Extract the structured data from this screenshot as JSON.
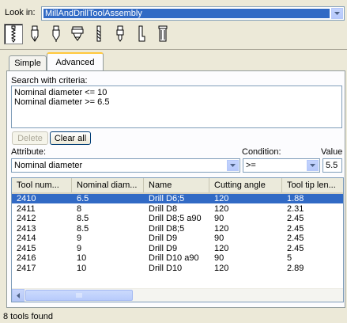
{
  "lookin": {
    "label": "Look in:",
    "value": "MillAndDrillToolAssembly"
  },
  "tools": [
    {
      "name": "drill-bit-icon"
    },
    {
      "name": "end-mill-icon"
    },
    {
      "name": "ball-mill-icon"
    },
    {
      "name": "face-mill-icon"
    },
    {
      "name": "reamer-icon"
    },
    {
      "name": "tap-icon"
    },
    {
      "name": "boring-bar-icon"
    },
    {
      "name": "holder-icon"
    }
  ],
  "tabs": {
    "simple": "Simple",
    "advanced": "Advanced"
  },
  "criteria": {
    "label": "Search with criteria:",
    "lines": [
      "Nominal diameter <= 10",
      "Nominal diameter >= 6.5"
    ]
  },
  "buttons": {
    "delete": "Delete",
    "clear_all": "Clear all"
  },
  "attribute": {
    "label": "Attribute:",
    "value": "Nominal diameter"
  },
  "condition": {
    "label": "Condition:",
    "value": ">="
  },
  "value": {
    "label": "Value",
    "value": "5.5"
  },
  "table": {
    "columns": [
      "Tool num...",
      "Nominal diam...",
      "Name",
      "Cutting angle",
      "Tool tip len..."
    ],
    "rows": [
      [
        "2410",
        "6.5",
        "Drill D6;5",
        "120",
        "1.88"
      ],
      [
        "2411",
        "8",
        "Drill D8",
        "120",
        "2.31"
      ],
      [
        "2412",
        "8.5",
        "Drill D8;5 a90",
        "90",
        "2.45"
      ],
      [
        "2413",
        "8.5",
        "Drill D8;5",
        "120",
        "2.45"
      ],
      [
        "2414",
        "9",
        "Drill D9",
        "90",
        "2.45"
      ],
      [
        "2415",
        "9",
        "Drill D9",
        "120",
        "2.45"
      ],
      [
        "2416",
        "10",
        "Drill D10 a90",
        "90",
        "5"
      ],
      [
        "2417",
        "10",
        "Drill D10",
        "120",
        "2.89"
      ]
    ],
    "selected_row": 0
  },
  "status": "8 tools found",
  "colors": {
    "selection": "#316ac5",
    "window": "#ece9d8",
    "tab_highlight": "#ffc83c"
  }
}
